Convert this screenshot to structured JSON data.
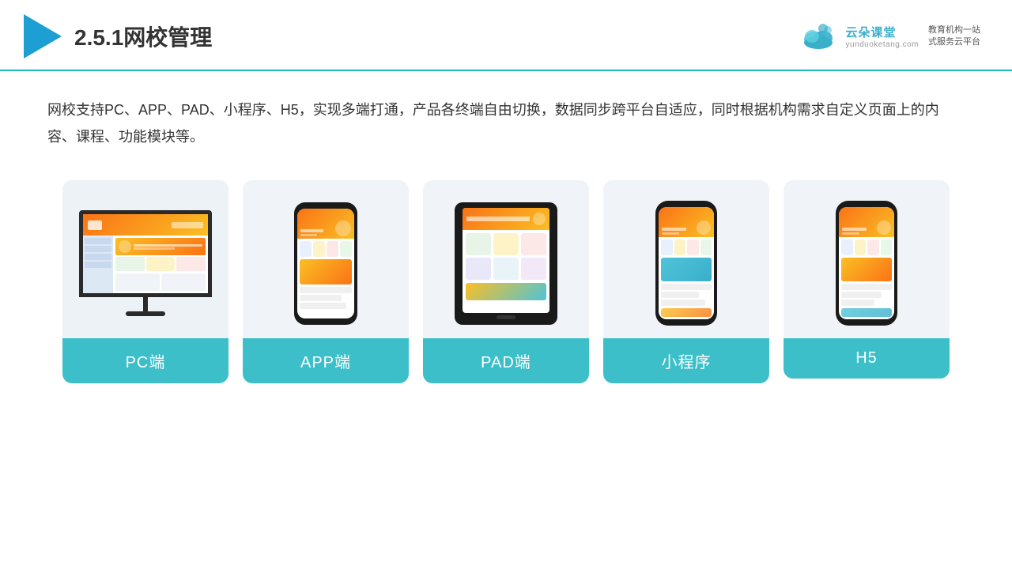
{
  "header": {
    "title": "2.5.1网校管理",
    "brand": {
      "name": "云朵课堂",
      "url": "yunduoketang.com",
      "slogan": "教育机构一站\n式服务云平台"
    }
  },
  "description": {
    "text": "网校支持PC、APP、PAD、小程序、H5，实现多端打通，产品各终端自由切换，数据同步跨平台自适应，同时根据机构需求自定义页面上的内容、课程、功能模块等。"
  },
  "cards": [
    {
      "label": "PC端",
      "type": "pc"
    },
    {
      "label": "APP端",
      "type": "phone"
    },
    {
      "label": "PAD端",
      "type": "tablet"
    },
    {
      "label": "小程序",
      "type": "phone"
    },
    {
      "label": "H5",
      "type": "phone"
    }
  ]
}
